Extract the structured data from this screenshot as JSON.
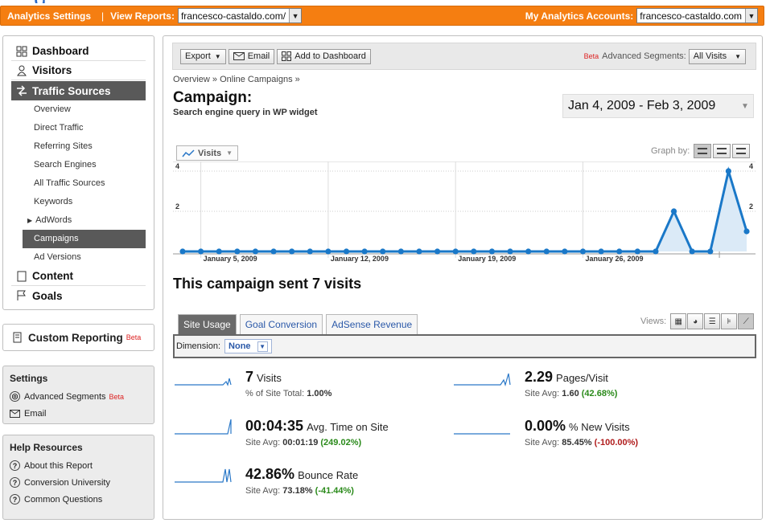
{
  "header": {
    "logo_fragment": "g",
    "title": "Analytics Settings",
    "separator": "|",
    "view_reports_label": "View Reports:",
    "view_reports_value": "francesco-castaldo.com/",
    "my_accounts_label": "My Analytics Accounts:",
    "my_accounts_value": "francesco-castaldo.com"
  },
  "nav": {
    "dashboard": "Dashboard",
    "visitors": "Visitors",
    "traffic_sources": "Traffic Sources",
    "sub": [
      "Overview",
      "Direct Traffic",
      "Referring Sites",
      "Search Engines",
      "All Traffic Sources",
      "Keywords",
      "AdWords",
      "Campaigns",
      "Ad Versions"
    ],
    "content": "Content",
    "goals": "Goals",
    "custom_reporting": "Custom Reporting",
    "beta": "Beta"
  },
  "settings": {
    "title": "Settings",
    "advanced_segments": "Advanced Segments",
    "beta": "Beta",
    "email": "Email"
  },
  "help": {
    "title": "Help Resources",
    "items": [
      "About this Report",
      "Conversion University",
      "Common Questions"
    ]
  },
  "toolbar": {
    "export": "Export",
    "email": "Email",
    "add_dashboard": "Add to Dashboard",
    "beta": "Beta",
    "adv_label": "Advanced Segments:",
    "adv_value": "All Visits"
  },
  "breadcrumb": "Overview » Online Campaigns »",
  "page": {
    "title": "Campaign:",
    "subtitle": "Search engine query in WP widget",
    "date_range": "Jan 4, 2009 - Feb 3, 2009"
  },
  "graph": {
    "metric_button": "Visits",
    "graph_by": "Graph by:"
  },
  "chart_data": {
    "type": "area",
    "x_tick_labels": [
      "January 5, 2009",
      "January 12, 2009",
      "January 19, 2009",
      "January 26, 2009"
    ],
    "y_ticks": [
      2,
      4
    ],
    "ylim": [
      0,
      4
    ],
    "series": [
      {
        "values": [
          0,
          0,
          0,
          0,
          0,
          0,
          0,
          0,
          0,
          0,
          0,
          0,
          0,
          0,
          0,
          0,
          0,
          0,
          0,
          0,
          0,
          0,
          0,
          0,
          0,
          0,
          0,
          2,
          0,
          0,
          4,
          1
        ]
      }
    ],
    "colors": {
      "line": "#1a78c8",
      "fill": "#dbeaf7"
    }
  },
  "summary": "This campaign sent 7 visits",
  "tabs": [
    "Site Usage",
    "Goal Conversion",
    "AdSense Revenue"
  ],
  "views_label": "Views:",
  "dimension": {
    "label": "Dimension:",
    "value": "None"
  },
  "metrics": {
    "visits": {
      "value": "7",
      "label": "Visits",
      "cmp_label": "% of Site Total:",
      "cmp_value": "1.00%"
    },
    "pages": {
      "value": "2.29",
      "label": "Pages/Visit",
      "cmp_label": "Site Avg:",
      "cmp_value": "1.60",
      "delta": "(42.68%)"
    },
    "time": {
      "value": "00:04:35",
      "label": "Avg. Time on Site",
      "cmp_label": "Site Avg:",
      "cmp_value": "00:01:19",
      "delta": "(249.02%)"
    },
    "new_visits": {
      "value": "0.00%",
      "label": "% New Visits",
      "cmp_label": "Site Avg:",
      "cmp_value": "85.45%",
      "delta": "(-100.00%)"
    },
    "bounce": {
      "value": "42.86%",
      "label": "Bounce Rate",
      "cmp_label": "Site Avg:",
      "cmp_value": "73.18%",
      "delta": "(-41.44%)"
    }
  }
}
